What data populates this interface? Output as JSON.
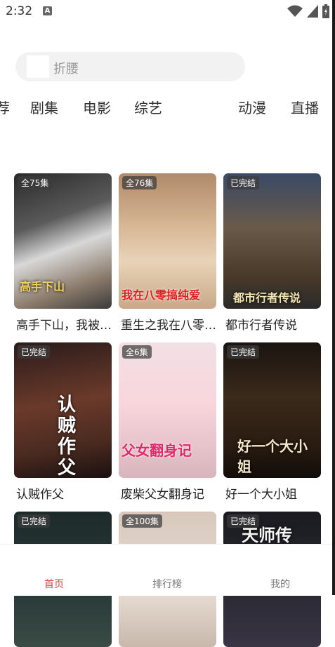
{
  "status": {
    "time": "2:32",
    "notif_letter": "A"
  },
  "search": {
    "placeholder": "折腰"
  },
  "tabs": [
    {
      "label": "荐"
    },
    {
      "label": "剧集"
    },
    {
      "label": "电影"
    },
    {
      "label": "综艺"
    },
    {
      "label": "动漫"
    },
    {
      "label": "直播"
    }
  ],
  "cards": [
    {
      "badge": "全75集",
      "title": "高手下山，我被…",
      "poster_text": "高手下山"
    },
    {
      "badge": "全76集",
      "title": "重生之我在八零…",
      "poster_text": "我在八零搞纯爱"
    },
    {
      "badge": "已完结",
      "title": "都市行者传说",
      "poster_text": "都市行者传说"
    },
    {
      "badge": "已完结",
      "title": "认贼作父",
      "poster_text": "认贼作父"
    },
    {
      "badge": "全6集",
      "title": "废柴父女翻身记",
      "poster_text": "父女翻身记"
    },
    {
      "badge": "已完结",
      "title": "好一个大小姐",
      "poster_text": "好一个大小姐"
    },
    {
      "badge": "已完结",
      "title": "",
      "poster_text": ""
    },
    {
      "badge": "全100集",
      "title": "",
      "poster_text": ""
    },
    {
      "badge": "已完结",
      "title": "",
      "poster_text": "天师传"
    }
  ],
  "nav": [
    {
      "label": "首页",
      "active": true
    },
    {
      "label": "排行榜",
      "active": false
    },
    {
      "label": "我的",
      "active": false
    }
  ],
  "colors": {
    "accent": "#e0443c",
    "search_bg": "#f2f2f2"
  }
}
